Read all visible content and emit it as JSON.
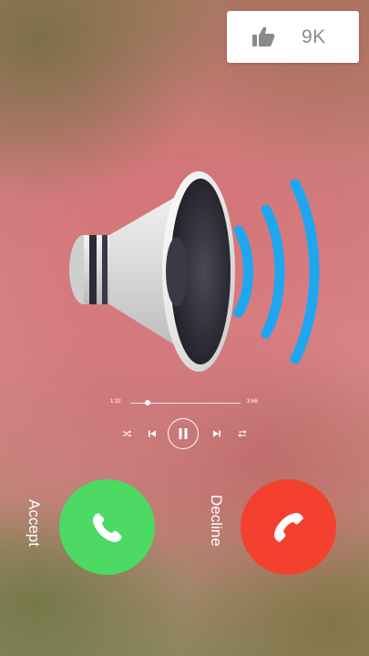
{
  "like": {
    "icon": "thumbs-up-icon",
    "count": "9K"
  },
  "media": {
    "current_time": "1:32",
    "total_time": "3:66",
    "progress": 0.13,
    "controls": [
      "shuffle-icon",
      "previous-icon",
      "pause-icon",
      "next-icon",
      "repeat-icon"
    ]
  },
  "call": {
    "accept_label": "Accept",
    "decline_label": "Decline"
  },
  "colors": {
    "accept": "#4cd964",
    "decline": "#f4412f",
    "sound_waves": "#1ea7f0"
  }
}
